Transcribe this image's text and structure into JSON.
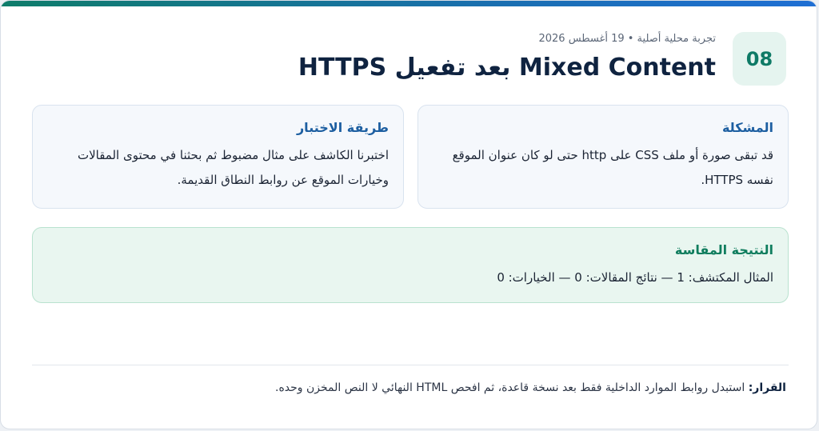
{
  "header": {
    "number": "08",
    "subtitle": "تجربة محلية أصلية • 19 أغسطس 2026",
    "title": "Mixed Content بعد تفعيل HTTPS"
  },
  "problem": {
    "heading": "المشكلة",
    "text": "قد تبقى صورة أو ملف CSS على http حتى لو كان عنوان الموقع نفسه HTTPS."
  },
  "method": {
    "heading": "طريقة الاختبار",
    "text": "اختبرنا الكاشف على مثال مضبوط ثم بحثنا في محتوى المقالات وخيارات الموقع عن روابط النطاق القديمة."
  },
  "result": {
    "heading": "النتيجة المقاسة",
    "text": "المثال المكتشف: 1 — نتائج المقالات: 0 — الخيارات: 0"
  },
  "decision": {
    "label": "القرار:",
    "text": "استبدل روابط الموارد الداخلية فقط بعد نسخة قاعدة، ثم افحص HTML النهائي لا النص المخزن وحده."
  },
  "colors": {
    "accent_green": "#0e7a66",
    "accent_blue": "#1d5fa1",
    "title": "#0f2340"
  }
}
